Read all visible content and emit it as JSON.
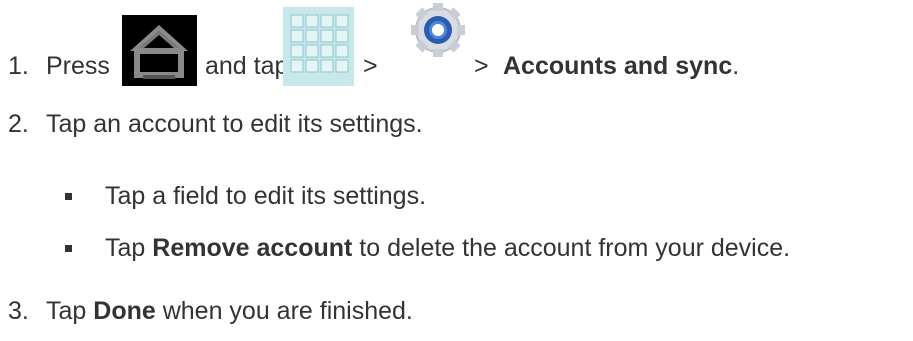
{
  "steps": [
    {
      "number": "1.",
      "text_press": "Press",
      "text_and_tap": "and tap",
      "sep1": ">",
      "sep2": ">",
      "bold_target": "Accounts and sync",
      "end_punct": "."
    },
    {
      "number": "2.",
      "text": "Tap an account to edit its settings.",
      "bullets": [
        {
          "text": "Tap a field to edit its settings."
        },
        {
          "prefix": "Tap",
          "bold": "Remove account",
          "suffix": "to delete the account from your device."
        }
      ]
    },
    {
      "number": "3.",
      "prefix": "Tap",
      "bold": "Done",
      "suffix": "when you are finished."
    }
  ],
  "icons": {
    "home": "home-icon",
    "apps": "apps-grid-icon",
    "settings": "settings-gear-icon"
  },
  "colors": {
    "text": "#333333",
    "home_icon_bg": "#000000",
    "apps_icon_bg": "#bfe3e6",
    "settings_icon_ring": "#2a5db0"
  }
}
